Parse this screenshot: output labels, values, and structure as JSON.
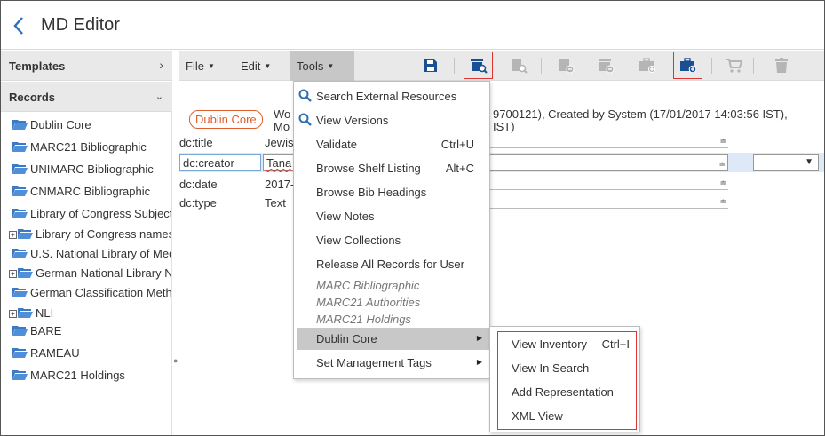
{
  "header": {
    "title": "MD Editor"
  },
  "sidebar": {
    "templates_label": "Templates",
    "records_label": "Records",
    "items": [
      {
        "label": "Dublin Core",
        "expandable": false
      },
      {
        "label": "MARC21 Bibliographic",
        "expandable": false
      },
      {
        "label": "UNIMARC Bibliographic",
        "expandable": false
      },
      {
        "label": "CNMARC Bibliographic",
        "expandable": false
      },
      {
        "label": "Library of Congress Subjects",
        "expandable": false
      },
      {
        "label": "Library of Congress names",
        "expandable": true
      },
      {
        "label": "U.S. National Library of Medicine",
        "expandable": false
      },
      {
        "label": "German National Library Names",
        "expandable": true
      },
      {
        "label": "German Classification Methods",
        "expandable": false
      },
      {
        "label": "NLI",
        "expandable": true
      },
      {
        "label": "BARE",
        "expandable": false
      },
      {
        "label": "RAMEAU",
        "expandable": false
      },
      {
        "label": "MARC21 Holdings",
        "expandable": false
      }
    ]
  },
  "toolbar": {
    "menus": [
      {
        "label": "File"
      },
      {
        "label": "Edit"
      },
      {
        "label": "Tools"
      }
    ],
    "icons": [
      "save-icon",
      "view-inventory-icon",
      "search-record-icon",
      "add-record-icon",
      "add-representation-icon",
      "add-bag-icon",
      "create-bag-icon",
      "cart-icon",
      "trash-icon"
    ]
  },
  "editor": {
    "badge": "Dublin Core",
    "info_line1_left": "Wo",
    "info_line2_left": "Mo",
    "info_line1_right": "9700121), Created by System (17/01/2017 14:03:56 IST),",
    "info_line2_right": "IST)",
    "rows": [
      {
        "tag": "dc:title",
        "value": "Jewis"
      },
      {
        "tag": "dc:creator",
        "value": "Tana"
      },
      {
        "tag": "dc:date",
        "value": "2017-"
      },
      {
        "tag": "dc:type",
        "value": "Text"
      }
    ]
  },
  "tools_menu": {
    "items": [
      {
        "label": "Search External Resources",
        "shortcut": ""
      },
      {
        "label": "View Versions",
        "shortcut": ""
      },
      {
        "label": "Validate",
        "shortcut": "Ctrl+U"
      },
      {
        "label": "Browse Shelf Listing",
        "shortcut": "Alt+C"
      },
      {
        "label": "Browse Bib Headings",
        "shortcut": ""
      },
      {
        "label": "View Notes",
        "shortcut": ""
      },
      {
        "label": "View Collections",
        "shortcut": ""
      },
      {
        "label": "Release All Records for User",
        "shortcut": ""
      }
    ],
    "categories": [
      "MARC Bibliographic",
      "MARC21 Authorities",
      "MARC21 Holdings"
    ],
    "dublin_core": "Dublin Core",
    "set_management_tags": "Set Management Tags"
  },
  "submenu": {
    "items": [
      {
        "label": "View Inventory",
        "shortcut": "Ctrl+I"
      },
      {
        "label": "View In Search",
        "shortcut": ""
      },
      {
        "label": "Add Representation",
        "shortcut": ""
      },
      {
        "label": "XML View",
        "shortcut": ""
      }
    ]
  },
  "colors": {
    "accent_blue": "#2f6fb3",
    "highlight_red": "#d33333",
    "badge_orange": "#e05d2c",
    "icon_gray": "#b5b5b5",
    "icon_blue": "#1c4f92"
  }
}
